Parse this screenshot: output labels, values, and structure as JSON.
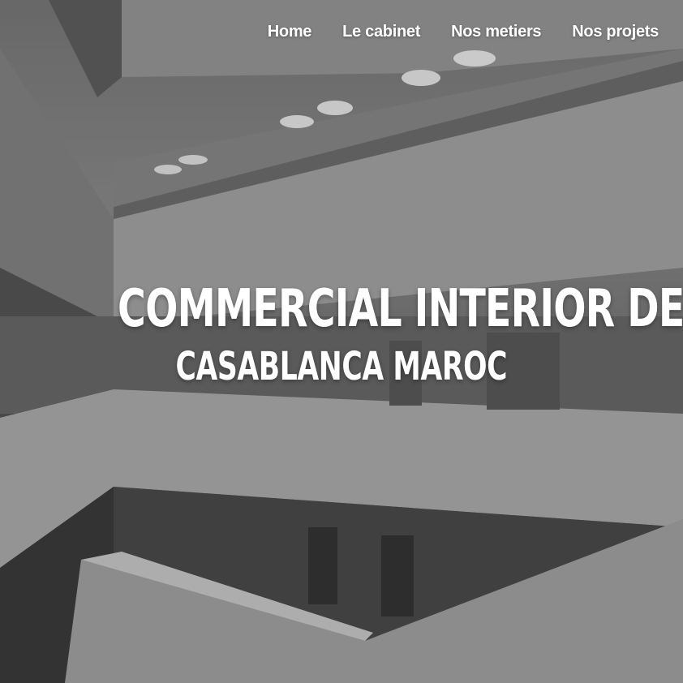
{
  "nav": {
    "items": [
      {
        "label": "Home"
      },
      {
        "label": "Le cabinet"
      },
      {
        "label": "Nos metiers"
      },
      {
        "label": "Nos projets"
      }
    ]
  },
  "hero": {
    "title": "COMMERCIAL INTERIOR DESIGN",
    "subtitle": "CASABLANCA MAROC"
  }
}
